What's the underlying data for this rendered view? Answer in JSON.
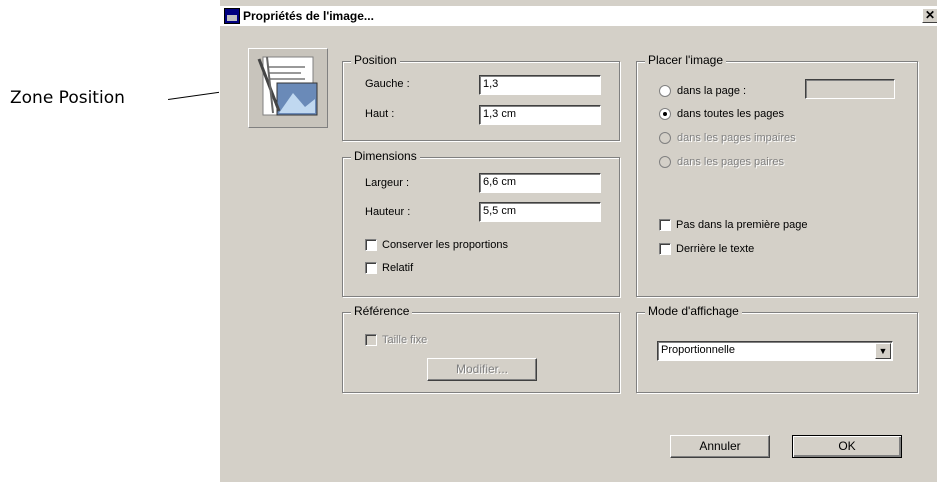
{
  "annotation": {
    "label": "Zone Position"
  },
  "window": {
    "title": "Propriétés de l'image...",
    "close_label": "✕"
  },
  "position": {
    "legend": "Position",
    "left_label": "Gauche :",
    "left_value": "1,3",
    "top_label": "Haut :",
    "top_value": "1,3 cm"
  },
  "dimensions": {
    "legend": "Dimensions",
    "width_label": "Largeur :",
    "width_value": "6,6 cm",
    "height_label": "Hauteur :",
    "height_value": "5,5 cm",
    "keep_proportions_label": "Conserver les proportions",
    "relative_label": "Relatif"
  },
  "reference": {
    "legend": "Référence",
    "fixed_size_label": "Taille fixe",
    "modify_label": "Modifier..."
  },
  "placement": {
    "legend": "Placer l'image",
    "radio_on_page": "dans la page :",
    "radio_all_pages": "dans toutes les pages",
    "radio_odd_pages": "dans les pages impaires",
    "radio_even_pages": "dans les pages paires",
    "not_first_page": "Pas dans la première page",
    "behind_text": "Derrière le texte"
  },
  "display_mode": {
    "legend": "Mode d'affichage",
    "selected": "Proportionnelle"
  },
  "buttons": {
    "cancel": "Annuler",
    "ok": "OK"
  }
}
